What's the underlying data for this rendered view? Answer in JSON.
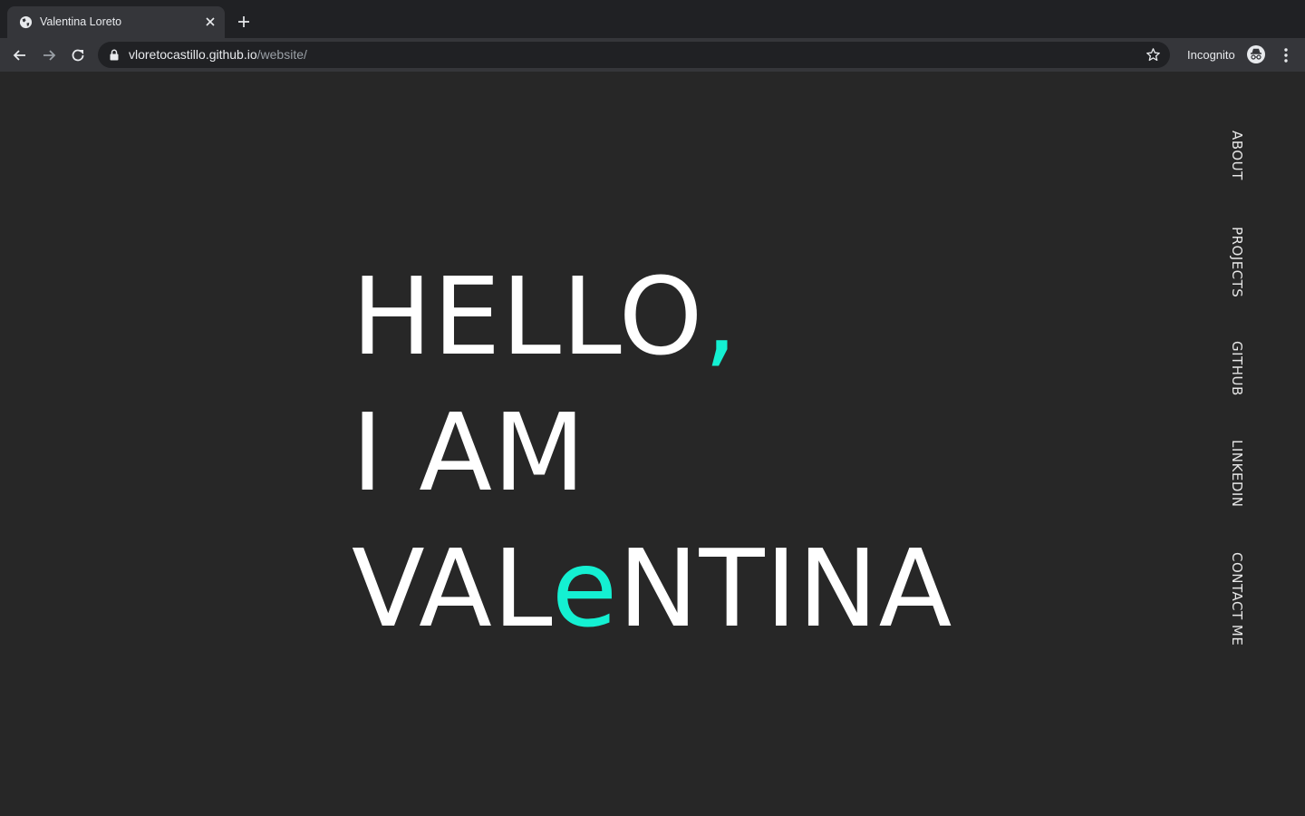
{
  "browser": {
    "tab_title": "Valentina Loreto",
    "url_host": "vloretocastillo.github.io",
    "url_path": "/website/",
    "profile_label": "Incognito"
  },
  "hero": {
    "line1_text": "HELLO",
    "line1_accent": ",",
    "line2": "I AM",
    "line3_before": "VAL",
    "line3_accent": "e",
    "line3_after": "NTINA"
  },
  "nav": {
    "items": [
      "ABOUT",
      "PROJECTS",
      "GITHUB",
      "LINKEDIN",
      "CONTACT ME"
    ]
  },
  "colors": {
    "background": "#272727",
    "text": "#ffffff",
    "accent": "#14f0d2"
  },
  "icons": {
    "favicon": "globe-icon",
    "close": "close-icon",
    "new_tab": "plus-icon",
    "back": "back-arrow-icon",
    "forward": "forward-arrow-icon",
    "reload": "reload-icon",
    "lock": "lock-icon",
    "bookmark": "star-icon",
    "incognito": "incognito-icon",
    "menu": "kebab-menu-icon"
  }
}
